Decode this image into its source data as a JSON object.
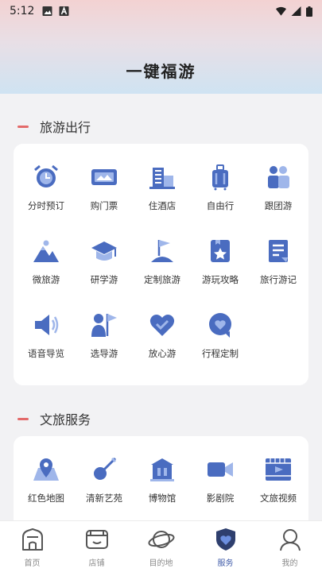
{
  "status_bar": {
    "time": "5:12"
  },
  "header": {
    "title": "一键福游"
  },
  "sections": [
    {
      "title": "旅游出行",
      "items": [
        {
          "label": "分时预订",
          "icon": "alarm-clock-icon"
        },
        {
          "label": "购门票",
          "icon": "ticket-icon"
        },
        {
          "label": "住酒店",
          "icon": "hotel-icon"
        },
        {
          "label": "自由行",
          "icon": "luggage-icon"
        },
        {
          "label": "跟团游",
          "icon": "group-icon"
        },
        {
          "label": "微旅游",
          "icon": "mountain-icon"
        },
        {
          "label": "研学游",
          "icon": "graduation-cap-icon"
        },
        {
          "label": "定制旅游",
          "icon": "flag-hill-icon"
        },
        {
          "label": "游玩攻略",
          "icon": "star-bookmark-icon"
        },
        {
          "label": "旅行游记",
          "icon": "notebook-icon"
        },
        {
          "label": "语音导览",
          "icon": "speaker-icon"
        },
        {
          "label": "选导游",
          "icon": "guide-flag-icon"
        },
        {
          "label": "放心游",
          "icon": "heart-icon"
        },
        {
          "label": "行程定制",
          "icon": "heart-chat-icon"
        }
      ]
    },
    {
      "title": "文旅服务",
      "items": [
        {
          "label": "红色地图",
          "icon": "map-pin-icon"
        },
        {
          "label": "清新艺苑",
          "icon": "brush-icon"
        },
        {
          "label": "博物馆",
          "icon": "museum-icon"
        },
        {
          "label": "影剧院",
          "icon": "video-camera-icon"
        },
        {
          "label": "文旅视频",
          "icon": "film-icon"
        }
      ]
    }
  ],
  "tabs": [
    {
      "label": "首页",
      "icon": "home-icon"
    },
    {
      "label": "店铺",
      "icon": "store-icon"
    },
    {
      "label": "目的地",
      "icon": "planet-icon"
    },
    {
      "label": "服务",
      "icon": "shield-heart-icon",
      "active": true
    },
    {
      "label": "我的",
      "icon": "user-icon"
    }
  ],
  "colors": {
    "accent": "#3e5aa8",
    "icon_primary": "#4a6cc0",
    "section_dash": "#e36a6a"
  }
}
